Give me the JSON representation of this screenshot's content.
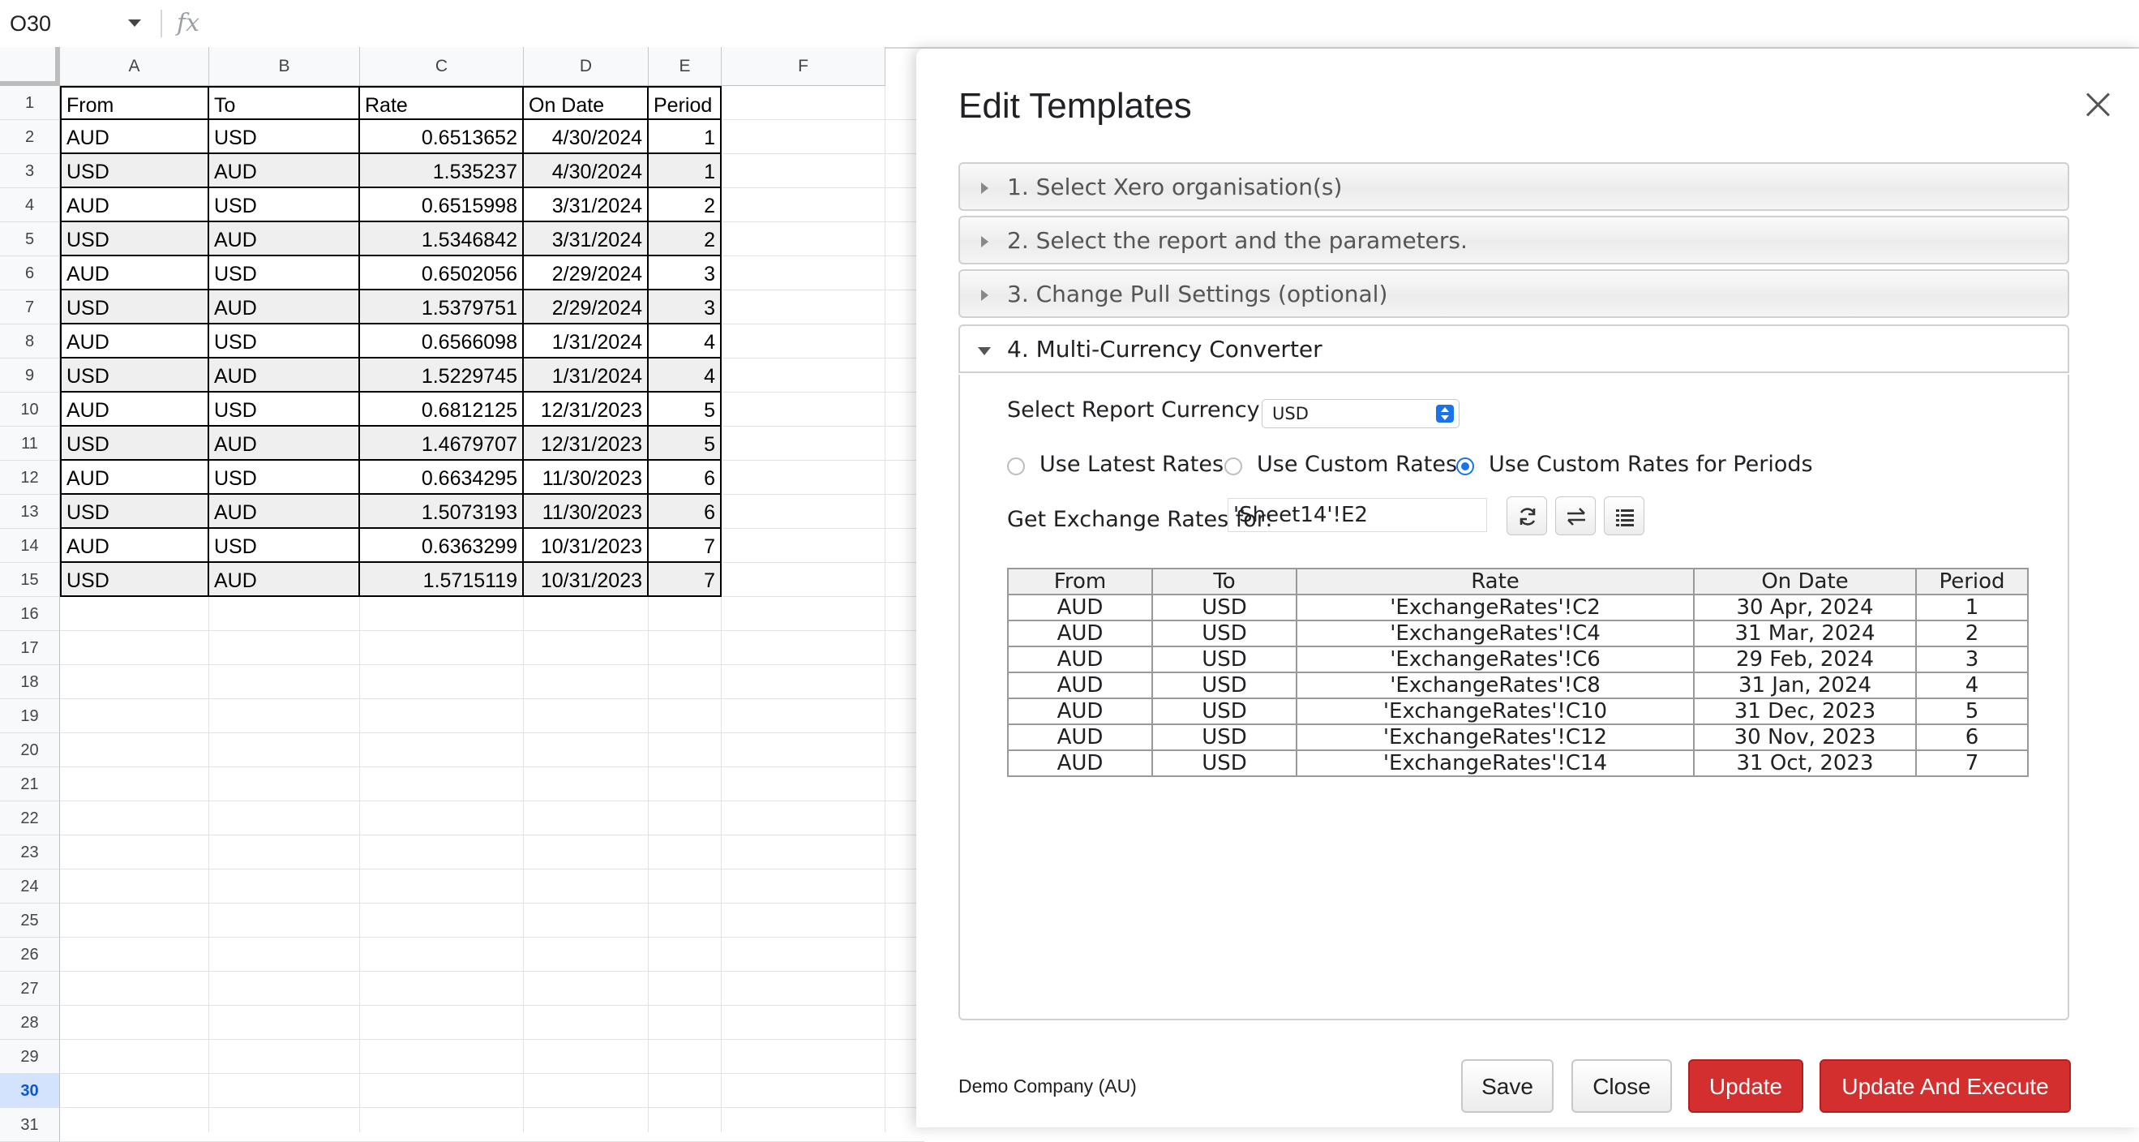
{
  "formula_bar": {
    "name_box": "O30",
    "fx_label": "fx"
  },
  "sheet": {
    "columns": [
      "A",
      "B",
      "C",
      "D",
      "E",
      "F"
    ],
    "row_numbers": [
      "1",
      "2",
      "3",
      "4",
      "5",
      "6",
      "7",
      "8",
      "9",
      "10",
      "11",
      "12",
      "13",
      "14",
      "15",
      "16",
      "17",
      "18",
      "19",
      "20",
      "21",
      "22",
      "23",
      "24",
      "25",
      "26",
      "27",
      "28",
      "29",
      "30",
      "31"
    ],
    "active_row": "30",
    "header": [
      "From",
      "To",
      "Rate",
      "On Date",
      "Period"
    ],
    "rows": [
      [
        "AUD",
        "USD",
        "0.6513652",
        "4/30/2024",
        "1"
      ],
      [
        "USD",
        "AUD",
        "1.535237",
        "4/30/2024",
        "1"
      ],
      [
        "AUD",
        "USD",
        "0.6515998",
        "3/31/2024",
        "2"
      ],
      [
        "USD",
        "AUD",
        "1.5346842",
        "3/31/2024",
        "2"
      ],
      [
        "AUD",
        "USD",
        "0.6502056",
        "2/29/2024",
        "3"
      ],
      [
        "USD",
        "AUD",
        "1.5379751",
        "2/29/2024",
        "3"
      ],
      [
        "AUD",
        "USD",
        "0.6566098",
        "1/31/2024",
        "4"
      ],
      [
        "USD",
        "AUD",
        "1.5229745",
        "1/31/2024",
        "4"
      ],
      [
        "AUD",
        "USD",
        "0.6812125",
        "12/31/2023",
        "5"
      ],
      [
        "USD",
        "AUD",
        "1.4679707",
        "12/31/2023",
        "5"
      ],
      [
        "AUD",
        "USD",
        "0.6634295",
        "11/30/2023",
        "6"
      ],
      [
        "USD",
        "AUD",
        "1.5073193",
        "11/30/2023",
        "6"
      ],
      [
        "AUD",
        "USD",
        "0.6363299",
        "10/31/2023",
        "7"
      ],
      [
        "USD",
        "AUD",
        "1.5715119",
        "10/31/2023",
        "7"
      ]
    ]
  },
  "dialog": {
    "title": "Edit Templates",
    "sections": [
      "1. Select Xero organisation(s)",
      "2. Select the report and the parameters.",
      "3. Change Pull Settings (optional)",
      "4. Multi-Currency Converter"
    ],
    "converter": {
      "currency_label": "Select Report Currency",
      "currency_value": "USD",
      "radios": [
        {
          "label": "Use Latest Rates",
          "checked": false
        },
        {
          "label": "Use Custom Rates",
          "checked": false
        },
        {
          "label": "Use Custom Rates for Periods",
          "checked": true
        }
      ],
      "range_label": "Get Exchange Rates for:",
      "range_value": "'Sheet14'!E2",
      "icons": [
        "refresh-icon",
        "swap-icon",
        "list-icon"
      ],
      "table_headers": [
        "From",
        "To",
        "Rate",
        "On Date",
        "Period"
      ],
      "table_rows": [
        [
          "AUD",
          "USD",
          "'ExchangeRates'!C2",
          "30 Apr, 2024",
          "1"
        ],
        [
          "AUD",
          "USD",
          "'ExchangeRates'!C4",
          "31 Mar, 2024",
          "2"
        ],
        [
          "AUD",
          "USD",
          "'ExchangeRates'!C6",
          "29 Feb, 2024",
          "3"
        ],
        [
          "AUD",
          "USD",
          "'ExchangeRates'!C8",
          "31 Jan, 2024",
          "4"
        ],
        [
          "AUD",
          "USD",
          "'ExchangeRates'!C10",
          "31 Dec, 2023",
          "5"
        ],
        [
          "AUD",
          "USD",
          "'ExchangeRates'!C12",
          "30 Nov, 2023",
          "6"
        ],
        [
          "AUD",
          "USD",
          "'ExchangeRates'!C14",
          "31 Oct, 2023",
          "7"
        ]
      ]
    },
    "footer": {
      "company": "Demo Company (AU)",
      "save": "Save",
      "close": "Close",
      "update": "Update",
      "update_execute": "Update And Execute"
    }
  },
  "colors": {
    "accent_blue": "#1a73e8",
    "button_red": "#d32f2f",
    "row_shade": "#efefef"
  }
}
